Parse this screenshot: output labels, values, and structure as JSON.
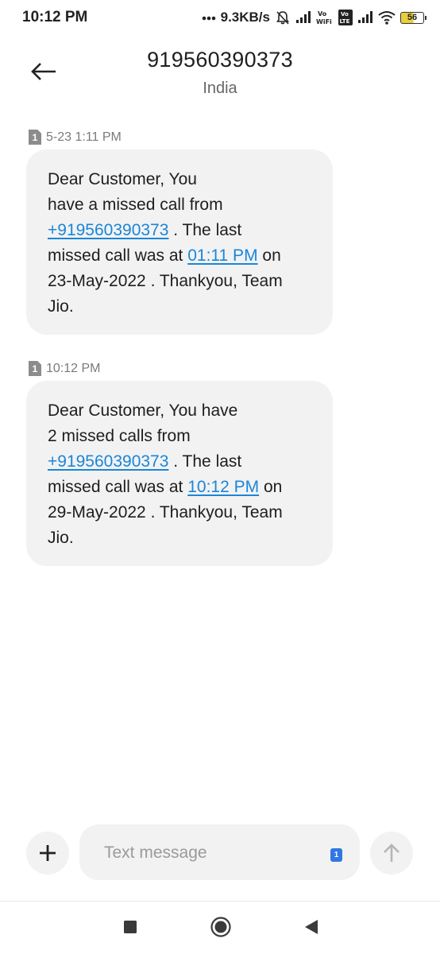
{
  "status_bar": {
    "time": "10:12 PM",
    "speed": "9.3KB/s",
    "battery": "56",
    "icons": [
      "dots-icon",
      "mute-icon",
      "signal-icon",
      "vowifi-icon",
      "volte-icon",
      "signal-icon",
      "wifi-icon",
      "battery-icon"
    ]
  },
  "header": {
    "title": "919560390373",
    "subtitle": "India"
  },
  "messages": [
    {
      "sim": "1",
      "timestamp": "5-23 1:11 PM",
      "text_line1": "Dear Customer, You",
      "text_line2": "have a missed call from",
      "phone_link": "+919560390373",
      "text_after_phone": " . The last",
      "text_line4": "missed call was at ",
      "time_link": "01:11 PM",
      "text_after_time": " on",
      "text_line5": "23-May-2022 . Thankyou, Team",
      "text_line6": "Jio."
    },
    {
      "sim": "1",
      "timestamp": "10:12 PM",
      "text_line1": "Dear Customer, You have",
      "text_line2": "2 missed calls from",
      "phone_link": "+919560390373",
      "text_after_phone": " . The last",
      "text_line4": "missed call was at ",
      "time_link": "10:12 PM",
      "text_after_time": " on",
      "text_line5": "29-May-2022 . Thankyou, Team",
      "text_line6": "Jio."
    }
  ],
  "composer": {
    "placeholder": "Text message",
    "sim": "1"
  },
  "colors": {
    "link": "#1a86d8",
    "bubble": "#f2f2f2",
    "sim_button": "#2f78e3"
  }
}
